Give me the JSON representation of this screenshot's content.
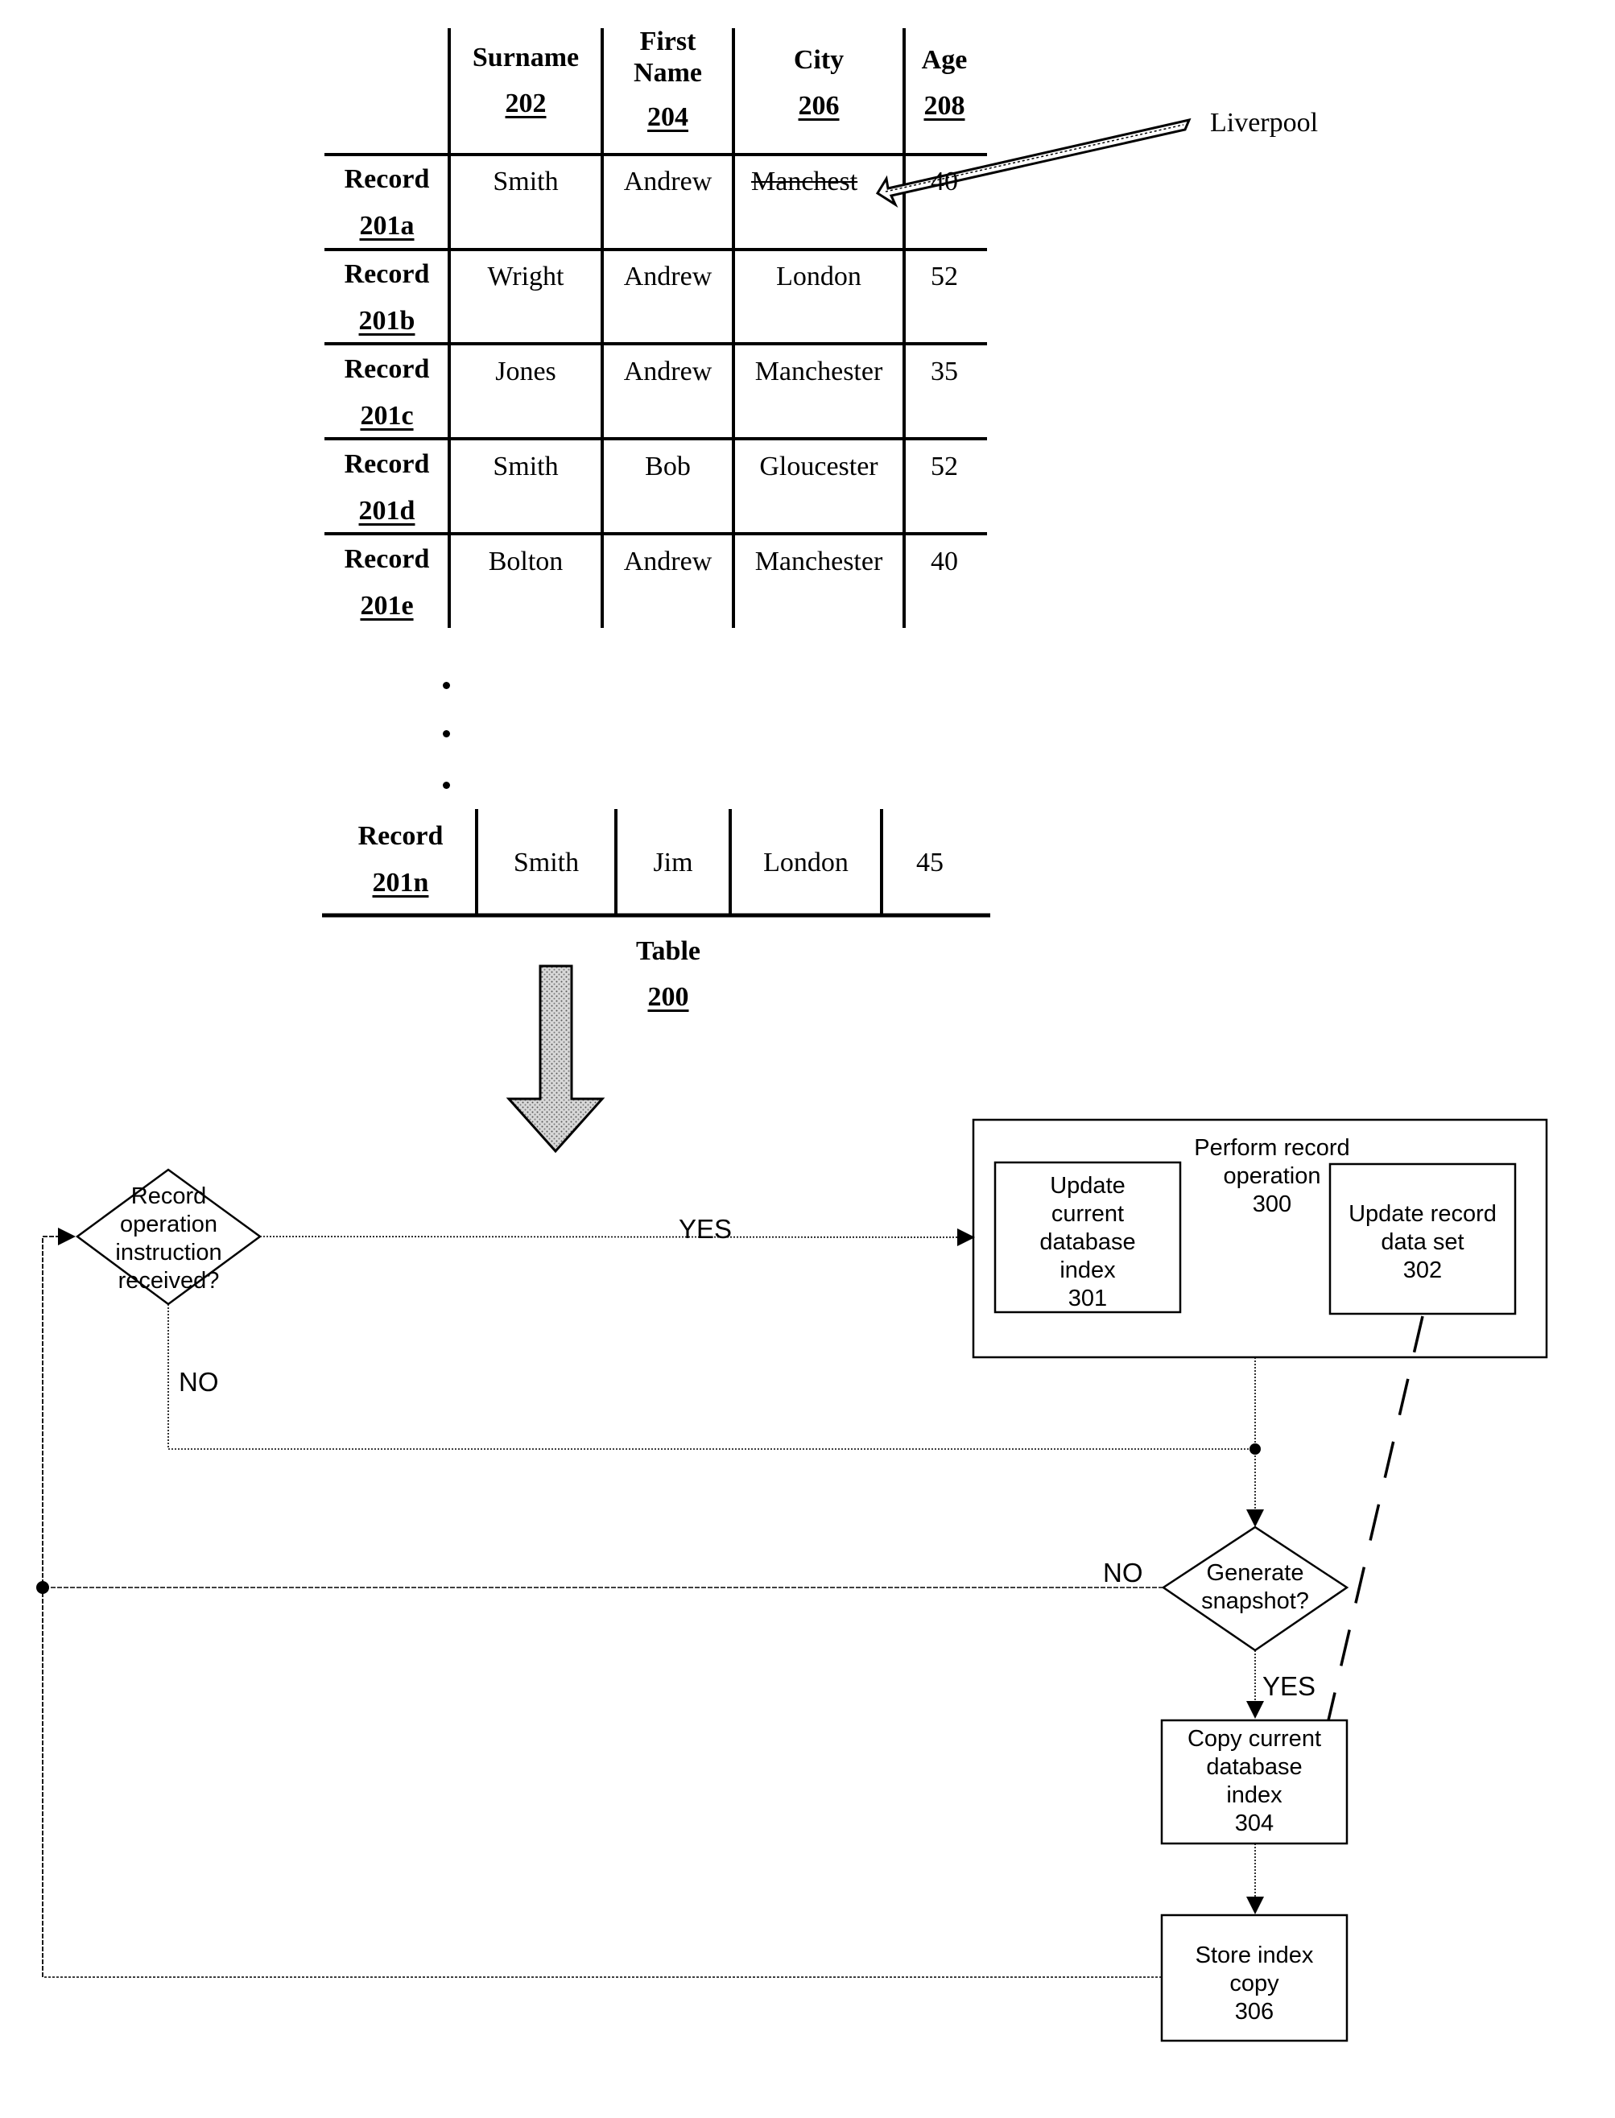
{
  "table": {
    "title": "Table",
    "ref": "200",
    "columns": [
      {
        "label": "Surname",
        "ref": "202"
      },
      {
        "label": "First Name",
        "ref": "204"
      },
      {
        "label": "City",
        "ref": "206"
      },
      {
        "label": "Age",
        "ref": "208"
      }
    ],
    "records": [
      {
        "label": "Record",
        "ref": "201a",
        "surname": "Smith",
        "first_name": "Andrew",
        "city": "Manchester",
        "city_display": "Manchest",
        "city_struck": true,
        "age": "40"
      },
      {
        "label": "Record",
        "ref": "201b",
        "surname": "Wright",
        "first_name": "Andrew",
        "city": "London",
        "age": "52"
      },
      {
        "label": "Record",
        "ref": "201c",
        "surname": "Jones",
        "first_name": "Andrew",
        "city": "Manchester",
        "age": "35"
      },
      {
        "label": "Record",
        "ref": "201d",
        "surname": "Smith",
        "first_name": "Bob",
        "city": "Gloucester",
        "age": "52"
      },
      {
        "label": "Record",
        "ref": "201e",
        "surname": "Bolton",
        "first_name": "Andrew",
        "city": "Manchester",
        "age": "40"
      }
    ],
    "ellipsis": "• • •",
    "last_record": {
      "label": "Record",
      "ref": "201n",
      "surname": "Smith",
      "first_name": "Jim",
      "city": "London",
      "age": "45"
    },
    "update_annotation": "Liverpool"
  },
  "flowchart": {
    "decision_record_op": {
      "lines": [
        "Record",
        "operation",
        "instruction",
        "received?"
      ]
    },
    "yes_label_1": "YES",
    "no_label_1": "NO",
    "perform_op": {
      "lines": [
        "Perform record",
        "operation",
        "300"
      ]
    },
    "update_index": {
      "lines": [
        "Update",
        "current",
        "database",
        "index",
        "301"
      ]
    },
    "update_dataset": {
      "lines": [
        "Update record",
        "data set",
        "302"
      ]
    },
    "decision_snapshot": {
      "lines": [
        "Generate",
        "snapshot?"
      ]
    },
    "no_label_2": "NO",
    "yes_label_2": "YES",
    "copy_index": {
      "lines": [
        "Copy current",
        "database",
        "index",
        "304"
      ]
    },
    "store_copy": {
      "lines": [
        "Store index",
        "copy",
        "306"
      ]
    }
  }
}
